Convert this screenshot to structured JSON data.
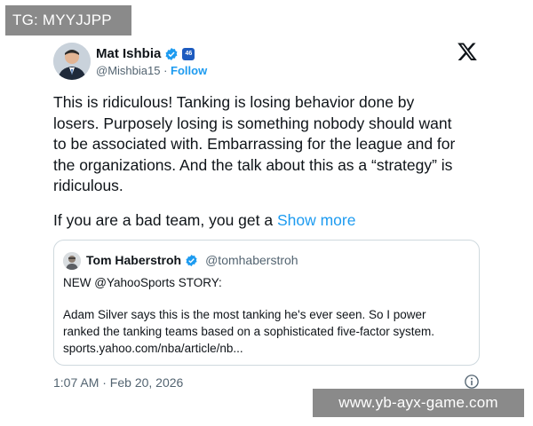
{
  "watermarks": {
    "top": "TG: MYYJJPP",
    "bottom": "www.yb-ayx-game.com"
  },
  "author": {
    "name": "Mat Ishbia",
    "handle": "@Mishbia15",
    "separator": "·",
    "follow_label": "Follow",
    "affiliation_badge_text": "46",
    "avatar_icon": "person-avatar",
    "verified_icon": "verified-badge-icon",
    "colors": {
      "verified": "#1d9bf0",
      "follow": "#1d9bf0",
      "affiliation": "#1d5bbf"
    }
  },
  "platform": {
    "logo_icon": "x-logo-icon"
  },
  "tweet": {
    "lines": [
      "This is ridiculous! Tanking is losing behavior done by",
      "losers. Purposely losing is something nobody should want",
      "to be associated with. Embarrassing for the league and for",
      "the organizations. And the talk about this as a “strategy” is",
      "ridiculous."
    ],
    "truncated_text": "If you are a bad team, you get a ",
    "show_more_label": "Show more"
  },
  "quote": {
    "name": "Tom Haberstroh",
    "handle": "@tomhaberstroh",
    "lines": [
      "NEW @YahooSports STORY:",
      "Adam Silver says this is the most tanking he's ever seen. So I power",
      "ranked the tanking teams based on a sophisticated five-factor system.",
      "sports.yahoo.com/nba/article/nb..."
    ]
  },
  "footer": {
    "timestamp": "1:07 AM · Feb 20, 2026",
    "info_icon": "info-icon"
  }
}
